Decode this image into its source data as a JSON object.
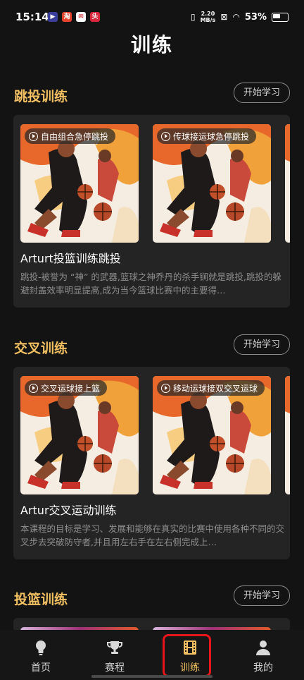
{
  "status_bar": {
    "time": "15:14",
    "net_speed_value": "2.20",
    "net_speed_unit": "MB/s",
    "battery": "53%"
  },
  "page": {
    "title": "训练"
  },
  "sections": [
    {
      "title": "跳投训练",
      "button": "开始学习",
      "videos": [
        "自由组合急停跳投",
        "传球接运球急停跳投"
      ],
      "course_title": "Arturt投篮训练跳投",
      "course_desc": "跳投-被誉为 “神” 的武器,篮球之神乔丹的杀手锏就是跳投,跳投的躲避封盖效率明显提高,成为当今篮球比赛中的主要得…"
    },
    {
      "title": "交叉训练",
      "button": "开始学习",
      "videos": [
        "交叉运球接上篮",
        "移动运球接双交叉运球"
      ],
      "course_title": "Artur交叉运动训练",
      "course_desc": "本课程的目标是学习、发展和能够在真实的比赛中使用各种不同的交叉步去突破防守者,并且用左右手在左右侧完成上…"
    },
    {
      "title": "投篮训练",
      "button": "开始学习"
    }
  ],
  "nav": [
    {
      "label": "首页",
      "icon": "lightbulb-icon"
    },
    {
      "label": "赛程",
      "icon": "trophy-icon"
    },
    {
      "label": "训练",
      "icon": "film-icon",
      "active": true
    },
    {
      "label": "我的",
      "icon": "person-icon"
    }
  ],
  "colors": {
    "accent": "#f2c062",
    "highlight": "#e8141a",
    "background": "#131313",
    "card": "#242424"
  }
}
